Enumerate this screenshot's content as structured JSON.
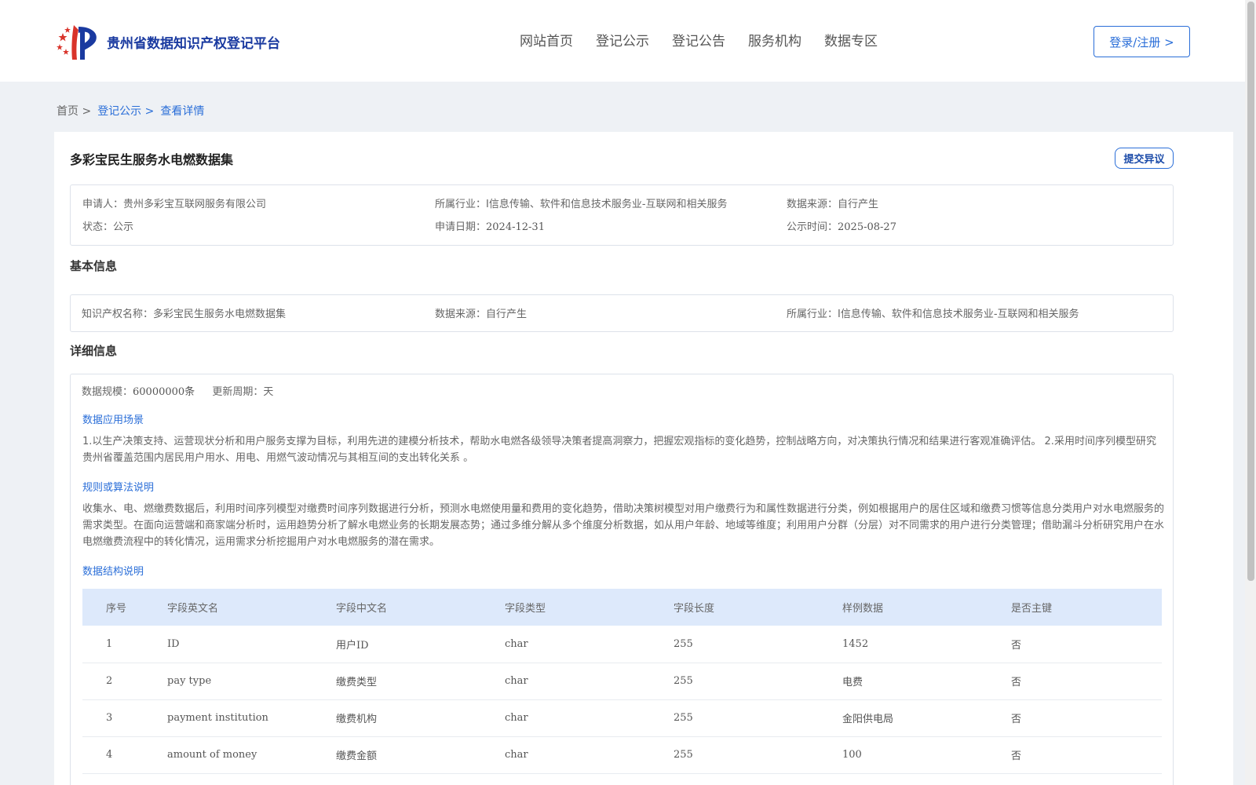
{
  "header": {
    "site_title": "贵州省数据知识产权登记平台",
    "nav": [
      "网站首页",
      "登记公示",
      "登记公告",
      "服务机构",
      "数据专区"
    ],
    "login_label": "登录/注册 >"
  },
  "breadcrumb": {
    "home": "首页 >",
    "section": "登记公示 >",
    "current": "查看详情"
  },
  "record": {
    "title": "多彩宝民生服务水电燃数据集",
    "objection_label": "提交异议",
    "applicant_label": "申请人：",
    "applicant": "贵州多彩宝互联网服务有限公司",
    "industry_label": "所属行业：",
    "industry": "I信息传输、软件和信息技术服务业-互联网和相关服务",
    "source_label": "数据来源：",
    "source": "自行产生",
    "status_label": "状态：",
    "status": "公示",
    "apply_date_label": "申请日期：",
    "apply_date": "2024-12-31",
    "publish_label": "公示时间：",
    "publish_date": "2025-08-27"
  },
  "basic": {
    "section_title": "基本信息",
    "ip_name_label": "知识产权名称：",
    "ip_name": "多彩宝民生服务水电燃数据集",
    "source_label": "数据来源：",
    "source": "自行产生",
    "industry_label": "所属行业：",
    "industry": "I信息传输、软件和信息技术服务业-互联网和相关服务"
  },
  "detail": {
    "section_title": "详细信息",
    "scale_label": "数据规模：",
    "scale": "60000000条",
    "cycle_label": "更新周期：",
    "cycle": "天",
    "scenario_title": "数据应用场景",
    "scenario_text": "1.以生产决策支持、运营现状分析和用户服务支撑为目标，利用先进的建模分析技术，帮助水电燃各级领导决策者提高洞察力，把握宏观指标的变化趋势，控制战略方向，对决策执行情况和结果进行客观准确评估。 2.采用时间序列模型研究贵州省覆盖范围内居民用户用水、用电、用燃气波动情况与其相互间的支出转化关系 。",
    "algo_title": "规则或算法说明",
    "algo_text": "收集水、电、燃缴费数据后，利用时间序列模型对缴费时间序列数据进行分析，预测水电燃使用量和费用的变化趋势，借助决策树模型对用户缴费行为和属性数据进行分类，例如根据用户的居住区域和缴费习惯等信息分类用户对水电燃服务的需求类型。在面向运营端和商家端分析时，运用趋势分析了解水电燃业务的长期发展态势；通过多维分解从多个维度分析数据，如从用户年龄、地域等维度；利用用户分群（分层）对不同需求的用户进行分类管理；借助漏斗分析研究用户在水电燃缴费流程中的转化情况，运用需求分析挖掘用户对水电燃服务的潜在需求。",
    "structure_title": "数据结构说明",
    "table": {
      "headers": [
        "序号",
        "字段英文名",
        "字段中文名",
        "字段类型",
        "字段长度",
        "样例数据",
        "是否主键"
      ],
      "rows": [
        [
          "1",
          "ID",
          "用户ID",
          "char",
          "255",
          "1452",
          "否"
        ],
        [
          "2",
          "pay type",
          "缴费类型",
          "char",
          "255",
          "电费",
          "否"
        ],
        [
          "3",
          "payment institution",
          "缴费机构",
          "char",
          "255",
          "金阳供电局",
          "否"
        ],
        [
          "4",
          "amount of money",
          "缴费金额",
          "char",
          "255",
          "100",
          "否"
        ]
      ]
    }
  }
}
